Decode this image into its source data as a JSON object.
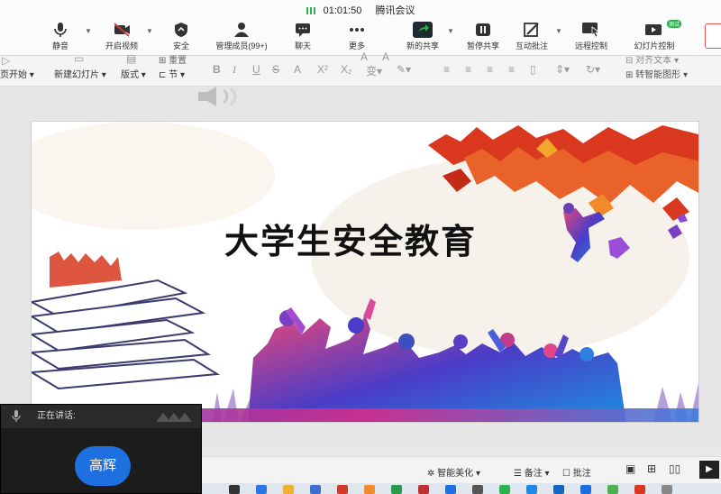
{
  "meeting": {
    "time": "01:01:50",
    "app_name": "腾讯会议",
    "buttons": {
      "mute": "静音",
      "video": "开启视频",
      "security": "安全",
      "members": "管理成员(99+)",
      "chat": "聊天",
      "more": "更多",
      "new_share": "新的共享",
      "pause_share": "暂停共享",
      "annotate": "互动批注",
      "remote": "远程控制",
      "slide_control": "幻灯片控制"
    },
    "slide_control_badge": "测试"
  },
  "ribbon": {
    "from_start": "页开始",
    "new_slide": "新建幻灯片",
    "layout": "版式",
    "section": "节",
    "reset": "重置",
    "to_smartart": "转智能图形",
    "align_text": "对齐文本"
  },
  "slide": {
    "title": "大学生安全教育"
  },
  "speaker": {
    "label": "正在讲话:",
    "name": "高辉"
  },
  "status": {
    "beautify": "智能美化",
    "notes": "备注",
    "comments": "批注"
  },
  "colors": {
    "accent_blue": "#1e6fe0",
    "maple_red": "#d9381e",
    "share_green": "#2bb24c"
  }
}
